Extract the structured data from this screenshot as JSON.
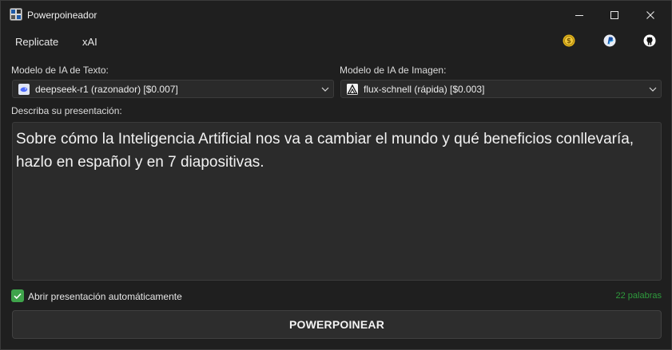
{
  "window": {
    "title": "Powerpoineador"
  },
  "menu": {
    "items": [
      "Replicate",
      "xAI"
    ]
  },
  "toolbar_icons": [
    "coin-icon",
    "paypal-icon",
    "github-icon"
  ],
  "text_model": {
    "label": "Modelo de IA de Texto:",
    "selected": "deepseek-r1 (razonador) [$0.007]"
  },
  "image_model": {
    "label": "Modelo de IA de Imagen:",
    "selected": "flux-schnell (rápida) [$0.003]"
  },
  "description": {
    "label": "Describa su presentación:",
    "value": "Sobre cómo la Inteligencia Artificial nos va a cambiar el mundo y qué beneficios conllevaría, hazlo en español y en 7 diapositivas."
  },
  "auto_open": {
    "label": "Abrir presentación automáticamente",
    "checked": true
  },
  "word_count": "22 palabras",
  "action_button": "POWERPOINEAR",
  "colors": {
    "accent_green": "#3fa44b",
    "word_count_green": "#2e9b3c",
    "background": "#1f1f1f"
  }
}
